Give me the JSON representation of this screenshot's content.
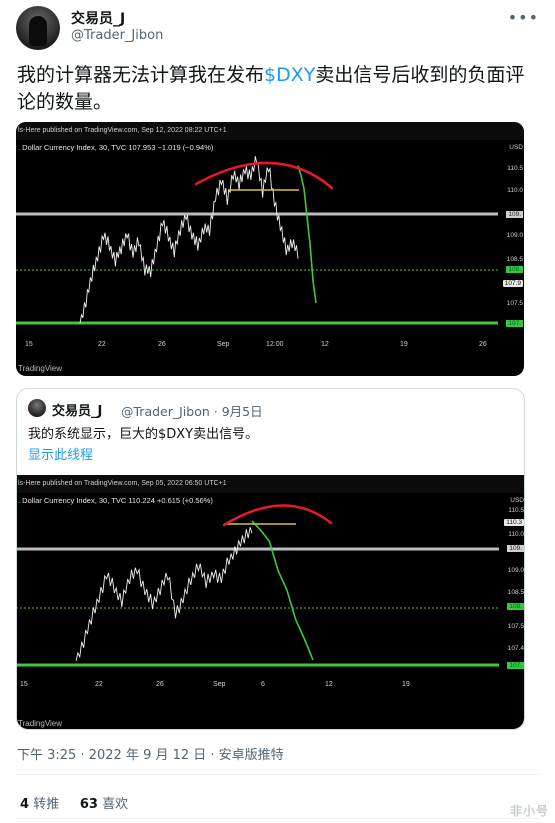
{
  "tweet": {
    "author_name": "交易员_J",
    "author_handle": "@Trader_Jibon",
    "more_icon": "more-horizontal-icon",
    "text_before": "我的计算器无法计算我在发布",
    "cashtag": "$DXY",
    "text_after": "卖出信号后收到的负面评论的数量。",
    "timestamp": "下午 3:25 · 2022 年 9 月 12 日 · 安卓版推特",
    "retweets_count": "4",
    "retweets_label": "转推",
    "likes_count": "63",
    "likes_label": "喜欢"
  },
  "quoted": {
    "author_name": "交易员_J",
    "author_handle": "@Trader_Jibon",
    "date": "· 9月5日",
    "text": "我的系统显示，巨大的$DXY卖出信号。",
    "show_thread": "显示此线程"
  },
  "watermark": "非小号",
  "colors": {
    "link": "#1d9bf0",
    "arc": "#e8192c",
    "projection": "#3ec93e",
    "flat_line": "#d8c437",
    "support": "#3ec93e",
    "resistance": "#bdbdbd"
  },
  "chart_data": [
    {
      "type": "line",
      "published": "ls-Here published on TradingView.com, Sep 12, 2022 08:22 UTC+1",
      "symbol_line": ". Dollar Currency Index, 30, TVC  107.953  −1.019 (−0.94%)",
      "currency": "USD",
      "footer": "TradingView",
      "x_ticks": [
        "15",
        "22",
        "26",
        "Sep",
        "12:00",
        "12",
        "19",
        "26"
      ],
      "y_ticks": [
        "110.5",
        "110.0",
        "109.",
        "109.0",
        "108.5",
        "108.",
        "107.9",
        "107.5",
        "107."
      ],
      "price_series": [
        106.9,
        107.4,
        107.9,
        108.4,
        108.8,
        108.6,
        108.3,
        108.5,
        108.9,
        108.4,
        108.7,
        108.1,
        108.0,
        108.6,
        109.1,
        108.8,
        108.5,
        108.9,
        109.3,
        108.8,
        108.6,
        109.0,
        108.9,
        109.7,
        110.0,
        109.6,
        110.2,
        109.9,
        110.3,
        110.1,
        110.5,
        109.8,
        110.3,
        109.6,
        109.0,
        108.5,
        108.7,
        108.4
      ],
      "projection_series": [
        110.3,
        110.2,
        109.8,
        109.3,
        108.6,
        107.9,
        107.3
      ]
    },
    {
      "type": "line",
      "published": "ls-Here published on TradingView.com, Sep 05, 2022 06:50 UTC+1",
      "symbol_line": ". Dollar Currency Index, 30, TVC  110.224  +0.615 (+0.56%)",
      "currency": "USD",
      "footer": "TradingView",
      "x_ticks": [
        "15",
        "22",
        "26",
        "Sep",
        "6",
        "12",
        "19"
      ],
      "y_ticks": [
        "110.5",
        "110.3",
        "110.0",
        "109.",
        "109.0",
        "108.5",
        "108.",
        "107.5",
        "107.4",
        "107."
      ],
      "price_series": [
        106.9,
        107.4,
        107.9,
        108.5,
        109.0,
        108.7,
        108.4,
        108.9,
        109.2,
        108.6,
        108.3,
        108.7,
        109.0,
        108.1,
        108.4,
        108.9,
        109.3,
        108.8,
        109.1,
        108.9,
        109.4,
        109.7,
        109.9,
        110.2
      ],
      "projection_series": [
        110.3,
        110.2,
        109.8,
        109.2,
        108.6,
        108.0,
        107.4,
        107.0
      ]
    }
  ]
}
